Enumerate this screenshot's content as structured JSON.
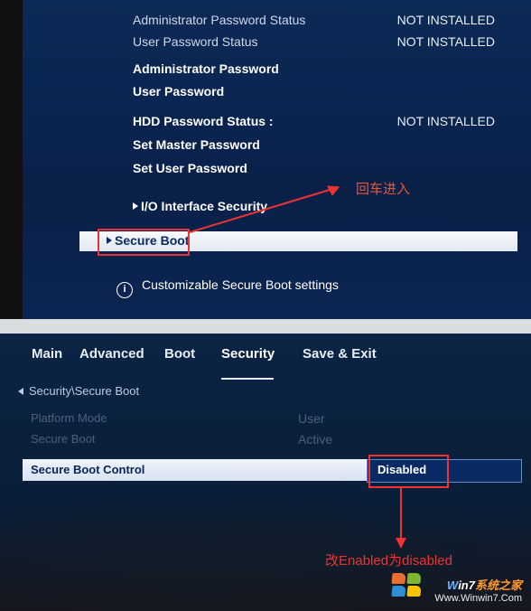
{
  "screen1": {
    "rows": {
      "admin_pw_status": "Administrator Password Status",
      "admin_pw_status_val": "NOT INSTALLED",
      "user_pw_status": "User Password Status",
      "user_pw_status_val": "NOT INSTALLED",
      "admin_pw": "Administrator Password",
      "user_pw": "User Password",
      "hdd_pw_status": "HDD Password Status  :",
      "hdd_pw_status_val": "NOT INSTALLED",
      "set_master_pw": "Set Master Password",
      "set_user_pw": "Set User Password",
      "io_security": "I/O Interface Security",
      "secure_boot": "Secure Boot"
    },
    "hint": "Customizable Secure Boot settings",
    "annotation": "回车进入"
  },
  "screen2": {
    "tabs": {
      "main": "Main",
      "advanced": "Advanced",
      "boot": "Boot",
      "security": "Security",
      "save_exit": "Save & Exit"
    },
    "breadcrumb": "Security\\Secure Boot",
    "rows": {
      "platform_mode": "Platform Mode",
      "platform_mode_val": "User",
      "secure_boot": "Secure Boot",
      "secure_boot_val": "Active",
      "secure_boot_control": "Secure Boot Control",
      "secure_boot_control_val": "Disabled"
    },
    "annotation": "改Enabled为disabled"
  },
  "watermark": {
    "brand_w": "W",
    "brand_in7": "in7",
    "brand_zh": "系统之家",
    "url": "Www.Winwin7.Com"
  }
}
